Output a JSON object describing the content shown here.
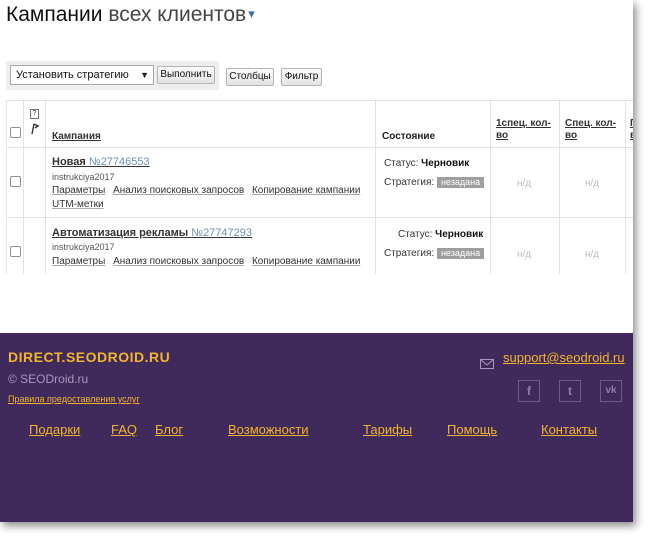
{
  "header": {
    "title": "Кампании",
    "subtitle": "всех клиентов",
    "dropdown_arrow": "▾"
  },
  "toolbar": {
    "strategy_select": "Установить стратегию",
    "execute_label": "Выполнить",
    "columns_label": "Столбцы",
    "filter_label": "Фильтр"
  },
  "table": {
    "columns": {
      "help": "?",
      "campaign": "Кампания",
      "status": "Состояние",
      "spec1_line1": "1спец. кол-",
      "spec1_line2": "во",
      "spec_line1": "Спец. кол-",
      "spec_line2": "во",
      "cut_line1": "П",
      "cut_line2": "в"
    },
    "rows": [
      {
        "name": "Новая",
        "number": "№27746553",
        "login": "instrukciya2017",
        "links": [
          "Параметры",
          "Анализ поисковых запросов",
          "Копирование кампании"
        ],
        "extra_link": "UTM-метки",
        "status_label": "Статус:",
        "status_value": "Черновик",
        "strategy_label": "Стратегия:",
        "strategy_value": "незадана",
        "spec1": "н/д",
        "spec": "н/д"
      },
      {
        "name": "Автоматизация рекламы",
        "number": "№27747293",
        "login": "instrukciya2017",
        "links": [
          "Параметры",
          "Анализ поисковых запросов",
          "Копирование кампании"
        ],
        "status_label": "Статус:",
        "status_value": "Черновик",
        "strategy_label": "Стратегия:",
        "strategy_value": "незадана",
        "spec1": "н/д",
        "spec": "н/д"
      }
    ]
  },
  "footer": {
    "brand": "DIRECT.SEODROID.RU",
    "copyright": "© SEODroid.ru",
    "terms": "Правила предоставления услуг",
    "email": "support@seodroid.ru",
    "social": [
      "facebook-icon",
      "twitter-icon",
      "vk-icon"
    ],
    "social_glyphs": {
      "facebook": "f",
      "twitter": "t",
      "vk": "vk"
    },
    "nav": [
      "Подарки",
      "FAQ",
      "Блог",
      "Возможности",
      "Тарифы",
      "Помощь",
      "Контакты"
    ],
    "colors": {
      "background": "#3f2a5b",
      "accent": "#f2b42c",
      "muted": "#a796bf"
    }
  }
}
